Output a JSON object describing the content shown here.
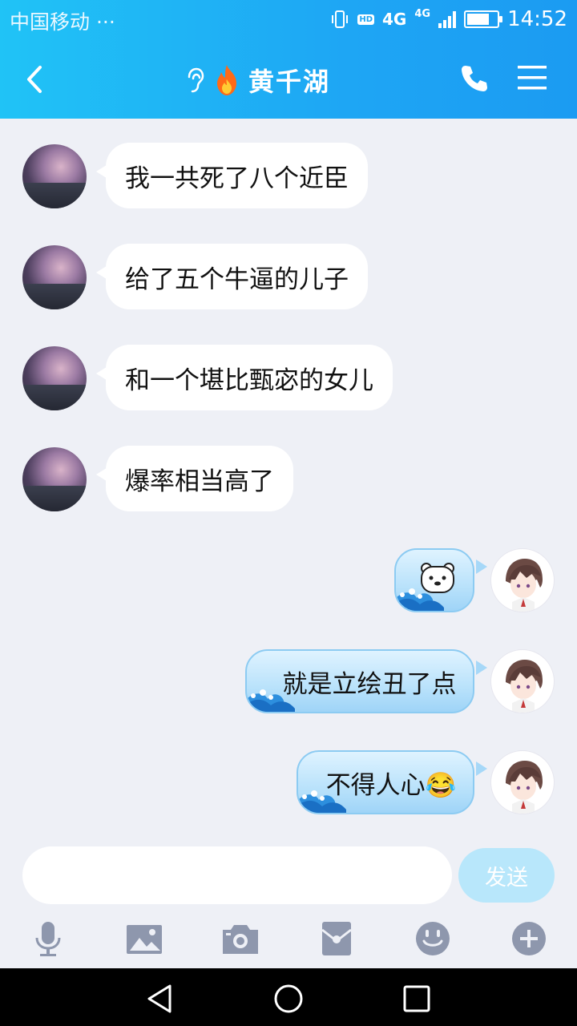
{
  "status_bar": {
    "carrier": "中国移动 ···",
    "hd": "HD",
    "network_4g": "4G",
    "network_4g_small": "4G",
    "time": "14:52",
    "battery_level": 0.75
  },
  "header": {
    "title": "黄千湖",
    "icons": [
      "back-chevron-icon",
      "ear-icon",
      "flame-icon",
      "phone-icon",
      "menu-icon"
    ]
  },
  "messages": [
    {
      "side": "received",
      "text": "我一共死了八个近臣"
    },
    {
      "side": "received",
      "text": "给了五个牛逼的儿子"
    },
    {
      "side": "received",
      "text": "和一个堪比甄宓的女儿"
    },
    {
      "side": "received",
      "text": "爆率相当高了"
    },
    {
      "side": "sent",
      "text": "",
      "sticker": "polar-bear-emoji"
    },
    {
      "side": "sent",
      "text": "就是立绘丑了点"
    },
    {
      "side": "sent",
      "text": "不得人心😂"
    }
  ],
  "input": {
    "value": "",
    "send_label": "发送"
  },
  "toolbar": {
    "icons": [
      "microphone-icon",
      "image-icon",
      "camera-icon",
      "red-packet-icon",
      "emoji-icon",
      "plus-icon"
    ]
  },
  "system_nav": {
    "icons": [
      "back-triangle-icon",
      "home-circle-icon",
      "recent-square-icon"
    ]
  },
  "colors": {
    "header_start": "#20c3f6",
    "header_end": "#1b9bf2",
    "chat_bg": "#eef0f6",
    "sent_bubble": "#b9e2fb",
    "send_button": "#b8e7fb",
    "toolbar_icon": "#8e97ad"
  }
}
